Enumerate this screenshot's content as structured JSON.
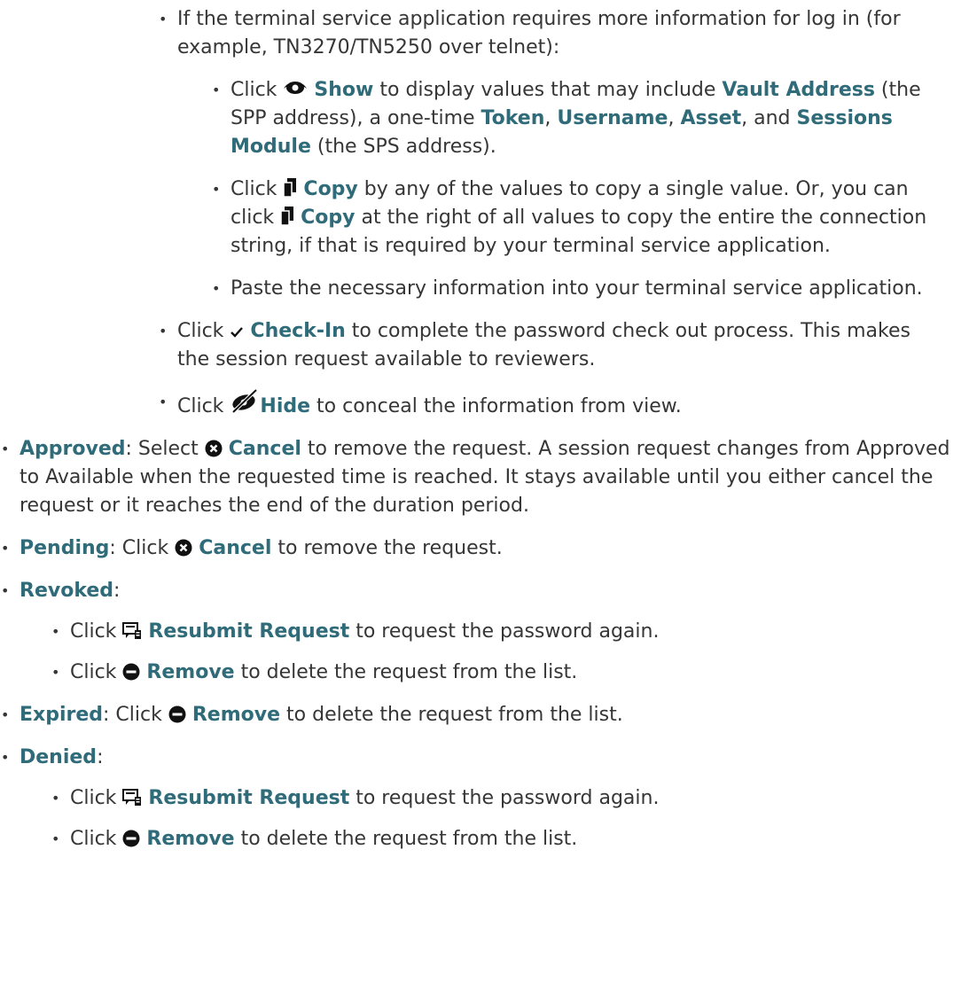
{
  "top_items": {
    "terminal": {
      "text1": "If the terminal service application requires more information for log in (for example, TN3270/TN5250 over telnet):",
      "sub": {
        "show": {
          "pre": "Click ",
          "label": "Show",
          "mid1": " to display values that may include ",
          "vault": "Vault Address",
          "mid2": " (the SPP address), a one-time ",
          "token": "Token",
          "comma1": ", ",
          "username": "Username",
          "comma2": ", ",
          "asset": "Asset",
          "mid3": ", and ",
          "sessions": "Sessions Module",
          "post": " (the SPS address)."
        },
        "copy": {
          "pre": "Click ",
          "label1": "Copy",
          "mid1": " by any of the values to copy a single value. Or, you can click ",
          "label2": "Copy",
          "post": " at the right of all values to copy the entire the connection string, if that is required by your terminal service application."
        },
        "paste": "Paste the necessary information into your terminal service application."
      }
    },
    "checkin": {
      "pre": "Click ",
      "label": "Check-In",
      "post": " to complete the password check out process. This makes the session request available to reviewers."
    },
    "hide": {
      "pre": "Click ",
      "label": "Hide",
      "post": " to conceal the information from view."
    }
  },
  "statuses": {
    "approved": {
      "label": "Approved",
      "pre": ": Select ",
      "action": "Cancel",
      "post": " to remove the request. A session request changes from Approved to Available when the requested time is reached. It stays available until you either cancel the request or it reaches the end of the duration period."
    },
    "pending": {
      "label": "Pending",
      "pre": ": Click ",
      "action": "Cancel",
      "post": " to remove the request."
    },
    "revoked": {
      "label": "Revoked",
      "colon": ":",
      "items": [
        {
          "pre": "Click ",
          "action": "Resubmit Request",
          "post": " to request the password again."
        },
        {
          "pre": "Click ",
          "action": "Remove",
          "post": " to delete the request from the list."
        }
      ]
    },
    "expired": {
      "label": "Expired",
      "pre": ": Click ",
      "action": "Remove",
      "post": " to delete the request from the list."
    },
    "denied": {
      "label": "Denied",
      "colon": ":",
      "items": [
        {
          "pre": "Click ",
          "action": "Resubmit Request",
          "post": " to request the password again."
        },
        {
          "pre": "Click ",
          "action": "Remove",
          "post": " to delete the request from the list."
        }
      ]
    }
  },
  "bullet_char": "•",
  "icons": {
    "show": "eye-icon",
    "copy": "copy-icon",
    "checkin": "checkmark-icon",
    "hide": "eye-slash-icon",
    "cancel": "cancel-circle-icon",
    "resubmit": "resubmit-request-icon",
    "remove": "remove-circle-icon"
  },
  "colors": {
    "text": "#363636",
    "bold_label": "#2f6b79",
    "icon": "#111111"
  }
}
